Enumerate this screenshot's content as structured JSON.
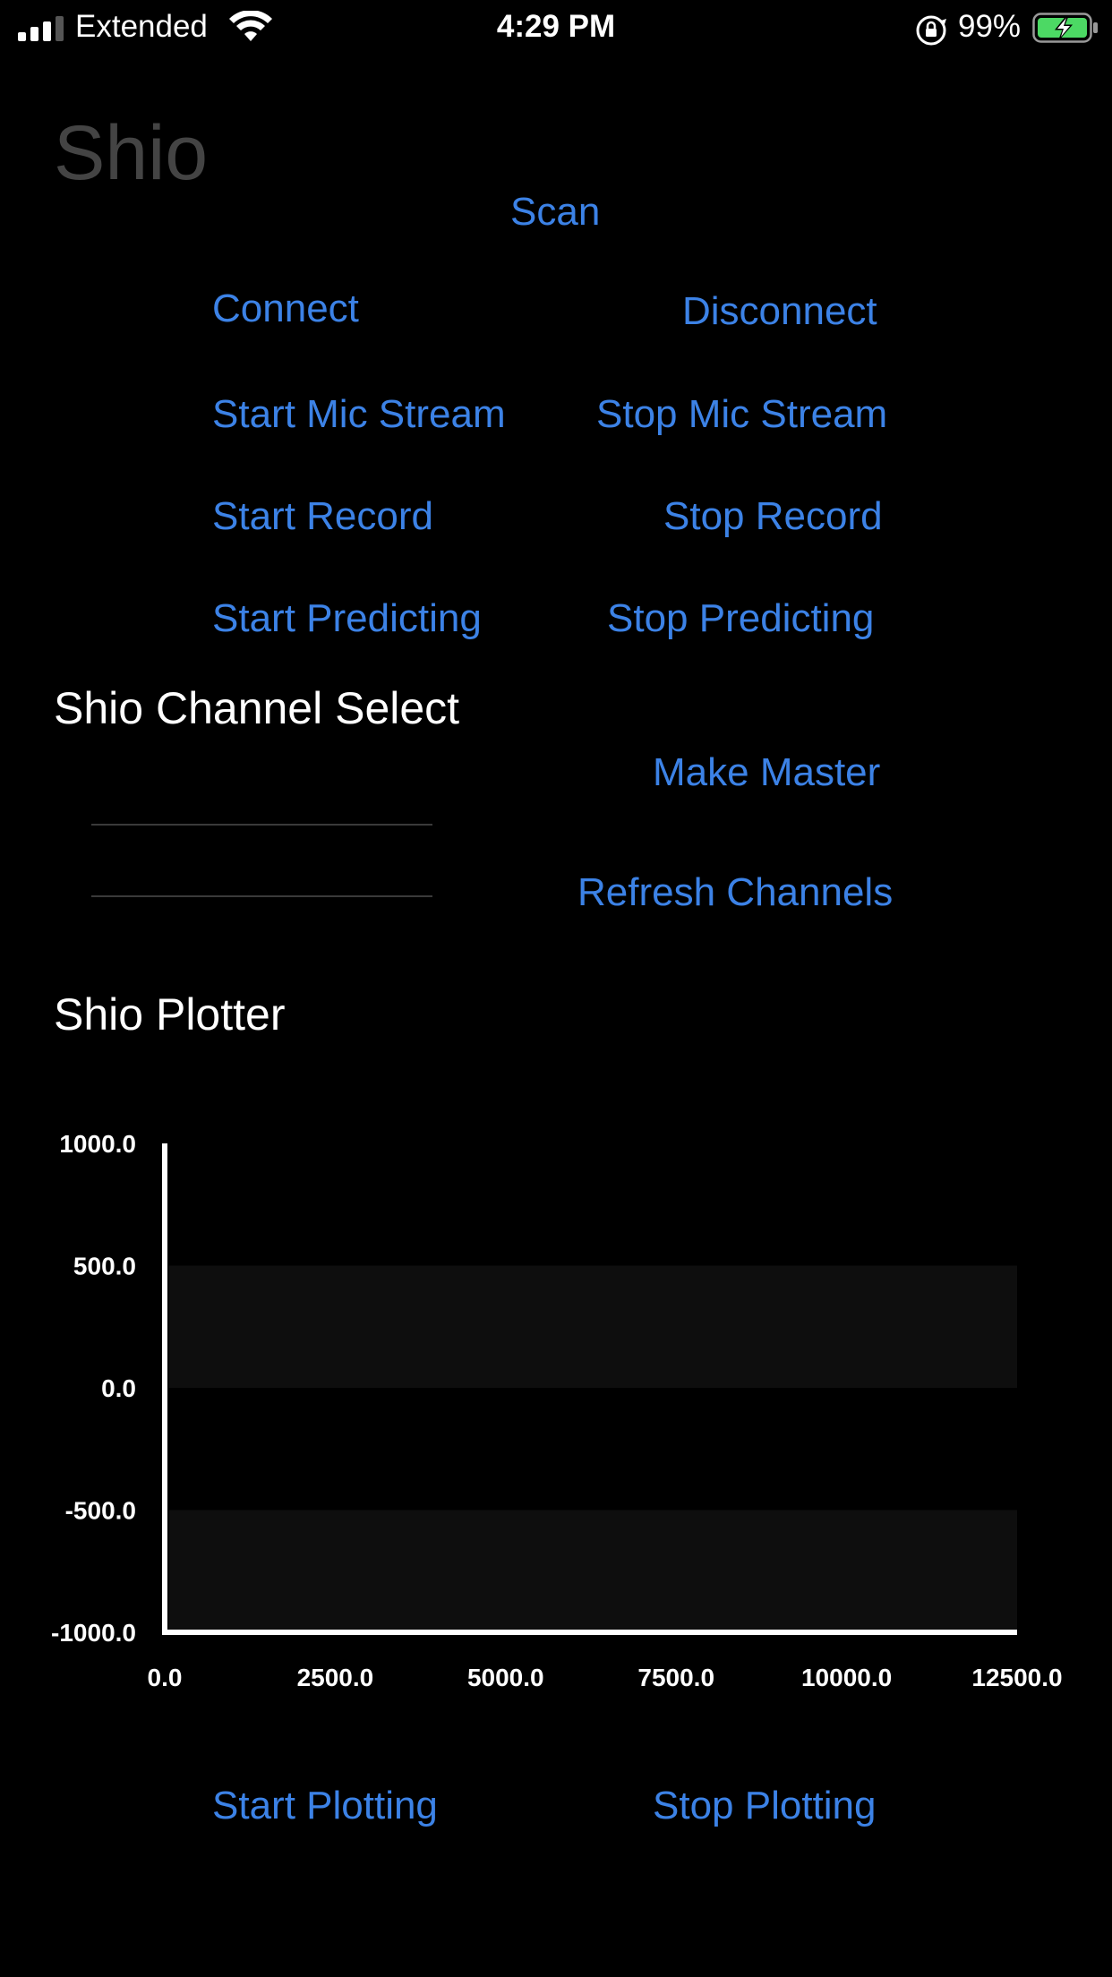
{
  "status_bar": {
    "carrier": "Extended",
    "time": "4:29 PM",
    "battery_percent": "99%"
  },
  "app": {
    "title": "Shio"
  },
  "buttons": {
    "scan": "Scan",
    "connect": "Connect",
    "disconnect": "Disconnect",
    "start_mic_stream": "Start Mic Stream",
    "stop_mic_stream": "Stop Mic Stream",
    "start_record": "Start Record",
    "stop_record": "Stop Record",
    "start_predicting": "Start Predicting",
    "stop_predicting": "Stop Predicting",
    "make_master": "Make Master",
    "refresh_channels": "Refresh Channels",
    "start_plotting": "Start Plotting",
    "stop_plotting": "Stop Plotting"
  },
  "channel_select": {
    "title": "Shio Channel Select"
  },
  "plotter": {
    "title": "Shio Plotter"
  },
  "chart_data": {
    "type": "line",
    "title": "",
    "xlabel": "",
    "ylabel": "",
    "xlim": [
      0,
      12500
    ],
    "ylim": [
      -1000,
      1000
    ],
    "x_ticks": [
      "0.0",
      "2500.0",
      "5000.0",
      "7500.0",
      "10000.0",
      "12500.0"
    ],
    "y_ticks": [
      "1000.0",
      "500.0",
      "0.0",
      "-500.0",
      "-1000.0"
    ],
    "shaded_bands": [
      [
        0,
        500
      ],
      [
        -1000,
        -500
      ]
    ],
    "series": []
  },
  "colors": {
    "accent": "#3c82e6",
    "background": "#000000",
    "battery": "#4cd964",
    "band": "#0e0e0e"
  }
}
